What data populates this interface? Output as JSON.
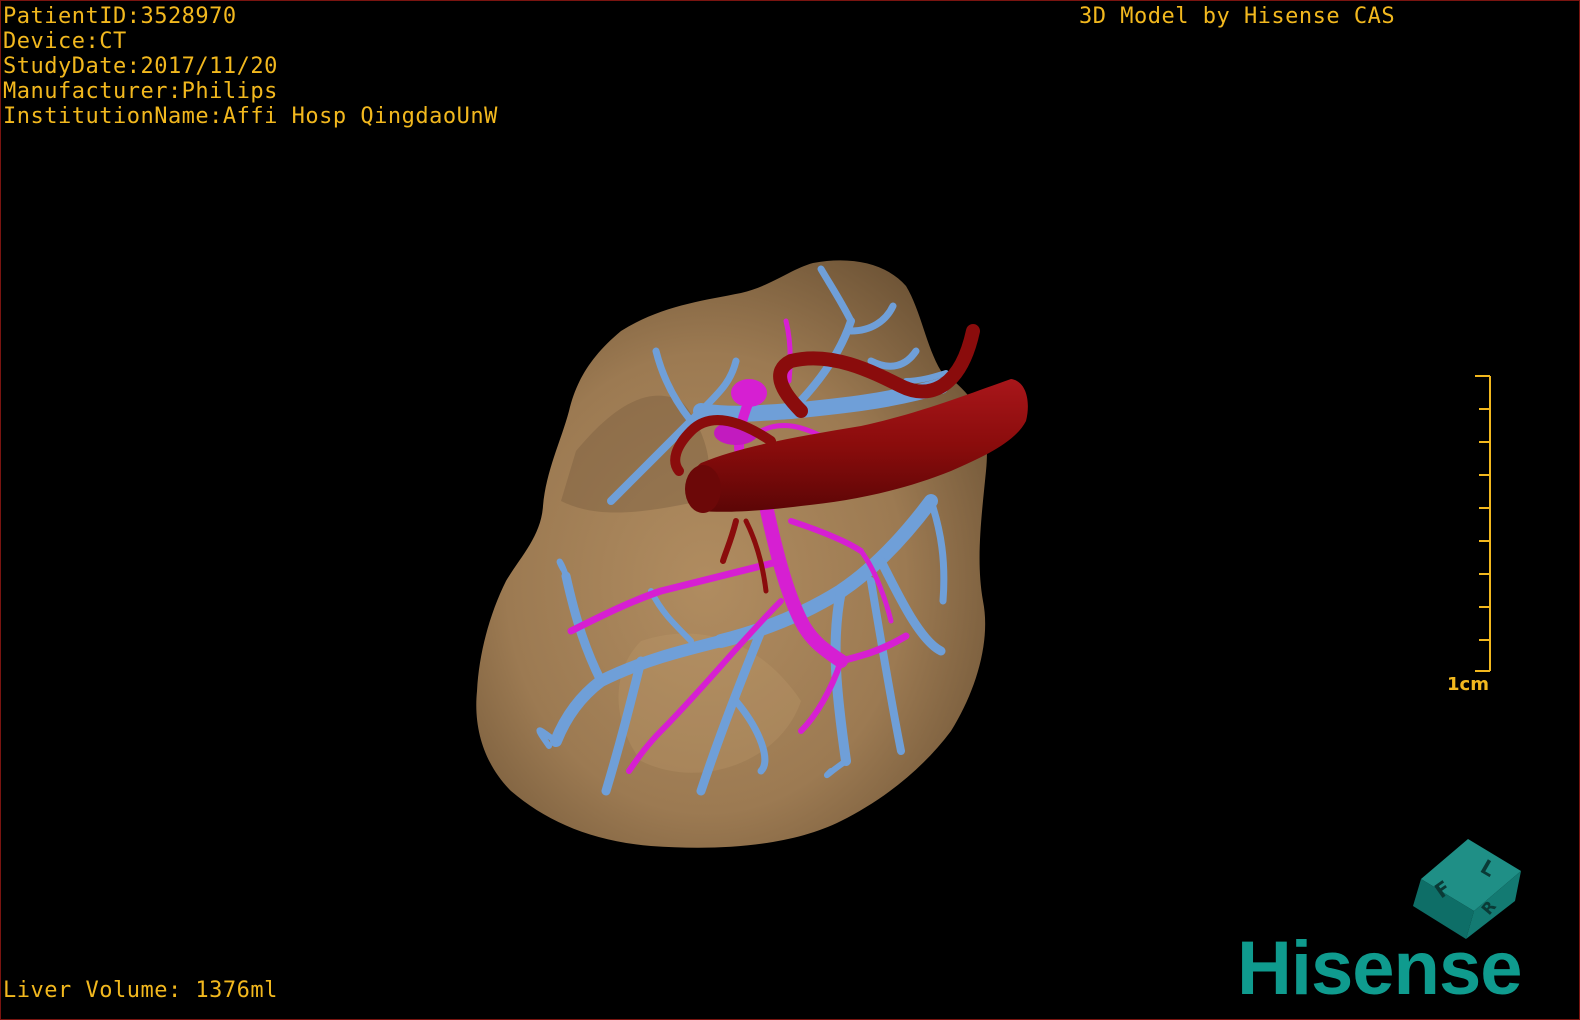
{
  "header": {
    "patient_id": "PatientID:3528970",
    "device": "Device:CT",
    "study_date": "StudyDate:2017/11/20",
    "manufacturer": "Manufacturer:Philips",
    "institution": "InstitutionName:Affi Hosp QingdaoUnW",
    "credit": "3D Model by Hisense CAS"
  },
  "footer": {
    "liver_volume": "Liver Volume: 1376ml"
  },
  "scale_bar": {
    "label": "1cm"
  },
  "orientation_cube": {
    "faces": [
      "F",
      "L",
      "R"
    ]
  },
  "brand": {
    "name": "Hisense"
  },
  "colors": {
    "overlay_text": "#f2b81e",
    "liver": "#9c7a52",
    "portal_vein": "#6f9fd8",
    "hepatic_artery": "#d61fd2",
    "vena_cava": "#8a0c0c",
    "brand": "#0f9b8e"
  }
}
